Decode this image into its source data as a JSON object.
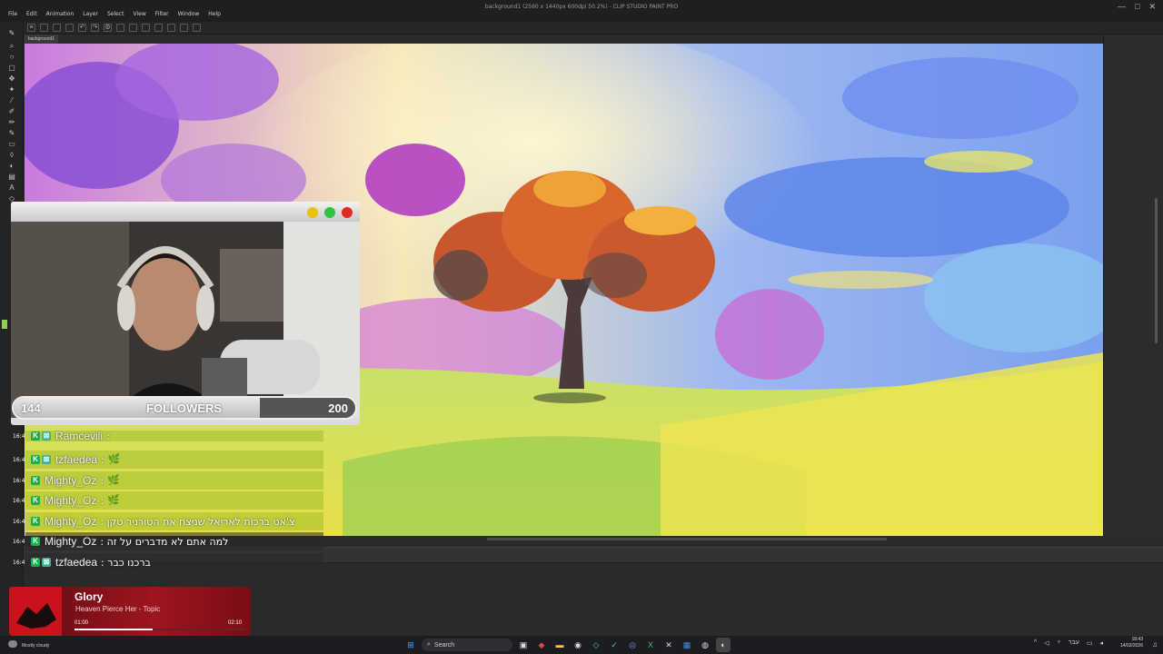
{
  "window": {
    "title": "background1 (2560 x 1440px 600dpi 50.2%) - CLIP STUDIO PAINT PRO",
    "minimize": "—",
    "maximize": "□",
    "close": "✕"
  },
  "menu": {
    "items": [
      "File",
      "Edit",
      "Animation",
      "Layer",
      "Select",
      "View",
      "Filter",
      "Window",
      "Help"
    ]
  },
  "document_tab": {
    "label": "background1"
  },
  "webcam": {
    "followers": {
      "current": "144",
      "label": "FOLLOWERS",
      "goal": "200",
      "progress": 0.72
    },
    "dots": {
      "yellow": "#e8c20d",
      "green": "#2ec443",
      "red": "#e02a20"
    }
  },
  "chat": {
    "messages": [
      {
        "time": "16:4",
        "user": "Ramcevili",
        "text": ":",
        "emote": ""
      },
      {
        "time": "16:4",
        "user": "tzfaedea",
        "text": ":",
        "emote": "🌿"
      },
      {
        "time": "16:4",
        "user": "Mighty_Oz",
        "text": ":",
        "emote": "🌿"
      },
      {
        "time": "16:4",
        "user": "Mighty_Oz",
        "text": ":",
        "emote": "🌿"
      },
      {
        "time": "16:4",
        "user": "Mighty_Oz",
        "text": ": צ'אט ברכות לאריאל שניצח את הטורניר טקן",
        "emote": ""
      },
      {
        "time": "16:4",
        "user": "Mighty_Oz",
        "text": ": למה אתם לא מדברים על זה",
        "emote": ""
      },
      {
        "time": "16:4",
        "user": "tzfaedea",
        "text": ": ברכנו כבר",
        "emote": ""
      }
    ]
  },
  "now_playing": {
    "title": "Glory",
    "artist": "Heaven Pierce Her - Topic",
    "elapsed": "01:00",
    "duration": "02:10",
    "progress": 0.46
  },
  "taskbar": {
    "weather": "Mostly cloudy",
    "search_placeholder": "Search",
    "language": "עבר",
    "time": "18:43",
    "date": "14/02/2026"
  },
  "colors": {
    "menubar": "#1f1f1f",
    "followers_fill": "#e8e8e8",
    "chat_row": "#a0be28",
    "now_playing": "#9d1520"
  }
}
